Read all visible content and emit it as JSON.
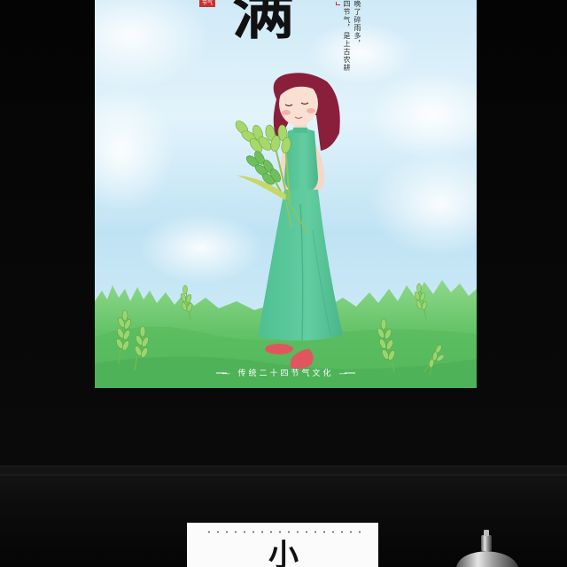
{
  "poster": {
    "seal_text": "节气",
    "title_char": "满",
    "vertical_text": [
      "晚了碎雨多，",
      "四节气，是上古农耕"
    ],
    "footer_text": "— 传统二十四节气文化 —"
  },
  "mini_card": {
    "title_char": "小"
  },
  "colors": {
    "sky": "#cfeaf7",
    "grass": "#6cc56a",
    "dress": "#5cc79a",
    "hair": "#8a1f3c",
    "shoes": "#e0565f",
    "seal": "#c8322f",
    "background": "#020202"
  },
  "icons": {
    "wheat": "wheat-icon",
    "bottle": "spray-bottle-icon"
  }
}
